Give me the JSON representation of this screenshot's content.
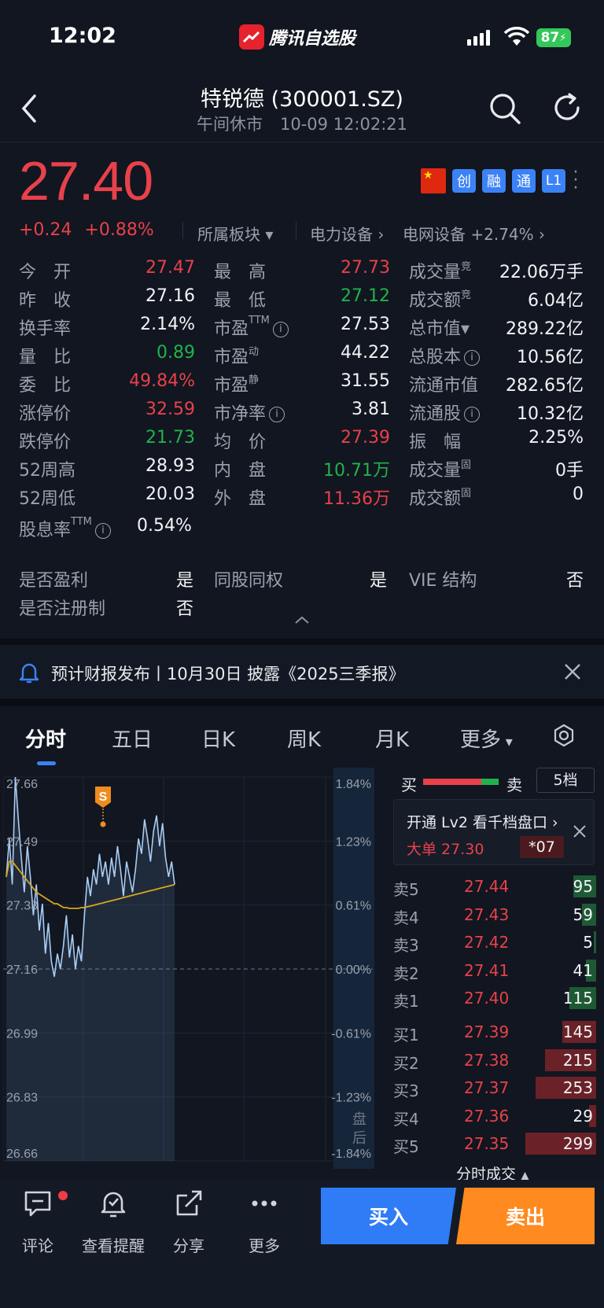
{
  "status": {
    "time": "12:02",
    "app_name": "腾讯自选股",
    "battery": "87"
  },
  "header": {
    "title": "特锐德 (300001.SZ)",
    "market_state": "午间休市",
    "datetime": "10-09 12:02:21"
  },
  "price": {
    "last": "27.40",
    "change": "+0.24",
    "change_pct": "+0.88%",
    "sector_label": "所属板块",
    "sector1": "电力设备",
    "sector2": "电网设备",
    "sector2_chg": "+2.74%",
    "tags": [
      "创",
      "融",
      "通",
      "L1"
    ]
  },
  "quote": {
    "col1": [
      {
        "label": "今　开",
        "value": "27.47",
        "color": "red"
      },
      {
        "label": "昨　收",
        "value": "27.16",
        "color": "white"
      },
      {
        "label": "换手率",
        "value": "2.14%",
        "color": "white"
      },
      {
        "label": "量　比",
        "value": "0.89",
        "color": "green"
      },
      {
        "label": "委　比",
        "value": "49.84%",
        "color": "red"
      },
      {
        "label": "涨停价",
        "value": "32.59",
        "color": "red"
      },
      {
        "label": "跌停价",
        "value": "21.73",
        "color": "green"
      },
      {
        "label": "52周高",
        "value": "28.93",
        "color": "white"
      },
      {
        "label": "52周低",
        "value": "20.03",
        "color": "white"
      }
    ],
    "col2": [
      {
        "label": "最　高",
        "value": "27.73",
        "color": "red"
      },
      {
        "label": "最　低",
        "value": "27.12",
        "color": "green"
      },
      {
        "label": "市盈",
        "sup": "TTM",
        "info": true,
        "value": "27.53",
        "color": "white"
      },
      {
        "label": "市盈",
        "sup": "动",
        "value": "44.22",
        "color": "white"
      },
      {
        "label": "市盈",
        "sup": "静",
        "value": "31.55",
        "color": "white"
      },
      {
        "label": "市净率",
        "info": true,
        "value": "3.81",
        "color": "white"
      },
      {
        "label": "均　价",
        "value": "27.39",
        "color": "red"
      },
      {
        "label": "内　盘",
        "value": "10.71万",
        "color": "green"
      },
      {
        "label": "外　盘",
        "value": "11.36万",
        "color": "red"
      }
    ],
    "col3": [
      {
        "label": "成交量",
        "sup": "竞",
        "value": "22.06万手"
      },
      {
        "label": "成交额",
        "sup": "竞",
        "value": "6.04亿"
      },
      {
        "label": "总市值▾",
        "value": "289.22亿"
      },
      {
        "label": "总股本",
        "info": true,
        "value": "10.56亿"
      },
      {
        "label": "流通市值",
        "value": "282.65亿"
      },
      {
        "label": "流通股",
        "info": true,
        "value": "10.32亿"
      },
      {
        "label": "振　幅",
        "value": "2.25%"
      },
      {
        "label": "成交量",
        "sup": "固",
        "value": "0手"
      },
      {
        "label": "成交额",
        "sup": "固",
        "value": "0"
      }
    ],
    "dividend_label": "股息率",
    "dividend_sup": "TTM",
    "dividend_value": "0.54%",
    "flags": [
      {
        "label": "是否盈利",
        "value": "是"
      },
      {
        "label": "同股同权",
        "value": "是"
      },
      {
        "label": "VIE 结构",
        "value": "否"
      },
      {
        "label": "是否注册制",
        "value": "否"
      }
    ]
  },
  "notice": {
    "text": "预计财报发布丨10月30日 披露《2025三季报》"
  },
  "tabs": [
    "分时",
    "五日",
    "日K",
    "周K",
    "月K",
    "更多"
  ],
  "chart_data": {
    "type": "line",
    "y_left_ticks": [
      "27.66",
      "27.49",
      "27.33",
      "27.16",
      "26.99",
      "26.83",
      "26.66"
    ],
    "y_right_ticks": [
      "1.84%",
      "1.23%",
      "0.61%",
      "0.00%",
      "-0.61%",
      "-1.23%",
      "-1.84%"
    ],
    "ylim": [
      26.66,
      27.66
    ],
    "prev_close": 27.16,
    "after_hours_label": "盘后",
    "marker": "S",
    "series": [
      {
        "values": [
          27.4,
          27.5,
          27.38,
          27.66,
          27.55,
          27.45,
          27.36,
          27.48,
          27.4,
          27.3,
          27.38,
          27.26,
          27.33,
          27.2,
          27.28,
          27.18,
          27.14,
          27.2,
          27.16,
          27.22,
          27.3,
          27.19,
          27.25,
          27.16,
          27.22,
          27.18,
          27.3,
          27.4,
          27.35,
          27.42,
          27.38,
          27.46,
          27.4,
          27.44,
          27.38,
          27.45,
          27.4,
          27.48,
          27.42,
          27.35,
          27.44,
          27.4,
          27.36,
          27.42,
          27.5,
          27.46,
          27.55,
          27.5,
          27.44,
          27.52,
          27.56,
          27.48,
          27.54,
          27.45,
          27.4,
          27.44,
          27.38
        ]
      },
      {
        "values": [
          27.4,
          27.44,
          27.44,
          27.43,
          27.42,
          27.41,
          27.4,
          27.39,
          27.38,
          27.37,
          27.36,
          27.355,
          27.35,
          27.345,
          27.34,
          27.335,
          27.33,
          27.33,
          27.325,
          27.32,
          27.32,
          27.318,
          27.318,
          27.318,
          27.318,
          27.32,
          27.32,
          27.322,
          27.324,
          27.326,
          27.328,
          27.33,
          27.332,
          27.334,
          27.336,
          27.338,
          27.34,
          27.342,
          27.344,
          27.346,
          27.348,
          27.35,
          27.352,
          27.354,
          27.356,
          27.358,
          27.36,
          27.362,
          27.364,
          27.366,
          27.368,
          27.37,
          27.372,
          27.374,
          27.376,
          27.378,
          27.38
        ]
      }
    ]
  },
  "orderbook": {
    "buy_label": "买",
    "sell_label": "卖",
    "depth_label": "5档",
    "lv2_title": "开通 Lv2 看千档盘口",
    "lv2_detail": "大单 27.30",
    "lv2_badge": "*07",
    "asks": [
      {
        "label": "卖5",
        "price": "27.44",
        "vol": "95",
        "ratio": 0.32
      },
      {
        "label": "卖4",
        "price": "27.43",
        "vol": "59",
        "ratio": 0.2
      },
      {
        "label": "卖3",
        "price": "27.42",
        "vol": "5",
        "ratio": 0.02
      },
      {
        "label": "卖2",
        "price": "27.41",
        "vol": "41",
        "ratio": 0.14
      },
      {
        "label": "卖1",
        "price": "27.40",
        "vol": "115",
        "ratio": 0.38
      }
    ],
    "bids": [
      {
        "label": "买1",
        "price": "27.39",
        "vol": "145",
        "ratio": 0.48
      },
      {
        "label": "买2",
        "price": "27.38",
        "vol": "215",
        "ratio": 0.72
      },
      {
        "label": "买3",
        "price": "27.37",
        "vol": "253",
        "ratio": 0.85
      },
      {
        "label": "买4",
        "price": "27.36",
        "vol": "29",
        "ratio": 0.1
      },
      {
        "label": "买5",
        "price": "27.35",
        "vol": "299",
        "ratio": 1.0
      }
    ],
    "tick_title": "分时成交"
  },
  "bottom": {
    "comment": "评论",
    "alert": "查看提醒",
    "share": "分享",
    "more": "更多",
    "buy": "买入",
    "sell": "卖出"
  }
}
